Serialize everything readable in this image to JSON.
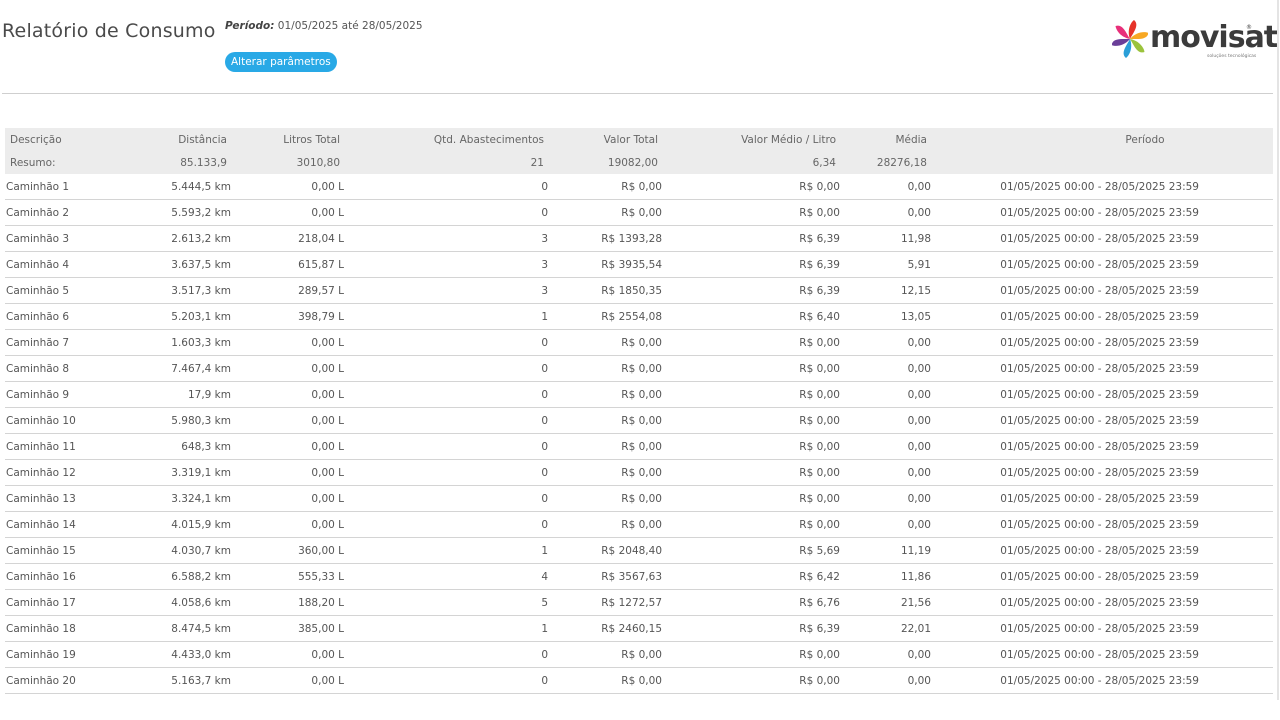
{
  "header": {
    "title": "Relatório de Consumo",
    "period_label": "Período:",
    "period_value": " 01/05/2025 até 28/05/2025",
    "change_button": "Alterar parâmetros"
  },
  "logo": {
    "wordmark": "movisat",
    "trademark": "®",
    "tagline": "soluções tecnológicas",
    "colors": [
      "#e63329",
      "#f7a823",
      "#9bc33c",
      "#2a9fd8",
      "#6a3e98",
      "#e8307a"
    ]
  },
  "table": {
    "columns": [
      "Descrição",
      "Distância",
      "Litros Total",
      "Qtd. Abastecimentos",
      "Valor Total",
      "Valor Médio / Litro",
      "Média",
      "Período"
    ],
    "summary": {
      "label": "Resumo:",
      "distance": "85.133,9",
      "liters": "3010,80",
      "refuels": "21",
      "total": "19082,00",
      "avg_price": "6,34",
      "average": "28276,18",
      "period": ""
    },
    "rows": [
      {
        "name": "Caminhão 1",
        "distance": "5.444,5 km",
        "liters": "0,00 L",
        "refuels": "0",
        "total": "R$ 0,00",
        "avg_price": "R$ 0,00",
        "average": "0,00",
        "period": "01/05/2025 00:00 - 28/05/2025 23:59"
      },
      {
        "name": "Caminhão 2",
        "distance": "5.593,2 km",
        "liters": "0,00 L",
        "refuels": "0",
        "total": "R$ 0,00",
        "avg_price": "R$ 0,00",
        "average": "0,00",
        "period": "01/05/2025 00:00 - 28/05/2025 23:59"
      },
      {
        "name": "Caminhão 3",
        "distance": "2.613,2 km",
        "liters": "218,04 L",
        "refuels": "3",
        "total": "R$ 1393,28",
        "avg_price": "R$ 6,39",
        "average": "11,98",
        "period": "01/05/2025 00:00 - 28/05/2025 23:59"
      },
      {
        "name": "Caminhão 4",
        "distance": "3.637,5 km",
        "liters": "615,87 L",
        "refuels": "3",
        "total": "R$ 3935,54",
        "avg_price": "R$ 6,39",
        "average": "5,91",
        "period": "01/05/2025 00:00 - 28/05/2025 23:59"
      },
      {
        "name": "Caminhão 5",
        "distance": "3.517,3 km",
        "liters": "289,57 L",
        "refuels": "3",
        "total": "R$ 1850,35",
        "avg_price": "R$ 6,39",
        "average": "12,15",
        "period": "01/05/2025 00:00 - 28/05/2025 23:59"
      },
      {
        "name": "Caminhão 6",
        "distance": "5.203,1 km",
        "liters": "398,79 L",
        "refuels": "1",
        "total": "R$ 2554,08",
        "avg_price": "R$ 6,40",
        "average": "13,05",
        "period": "01/05/2025 00:00 - 28/05/2025 23:59"
      },
      {
        "name": "Caminhão 7",
        "distance": "1.603,3 km",
        "liters": "0,00 L",
        "refuels": "0",
        "total": "R$ 0,00",
        "avg_price": "R$ 0,00",
        "average": "0,00",
        "period": "01/05/2025 00:00 - 28/05/2025 23:59"
      },
      {
        "name": "Caminhão 8",
        "distance": "7.467,4 km",
        "liters": "0,00 L",
        "refuels": "0",
        "total": "R$ 0,00",
        "avg_price": "R$ 0,00",
        "average": "0,00",
        "period": "01/05/2025 00:00 - 28/05/2025 23:59"
      },
      {
        "name": "Caminhão 9",
        "distance": "17,9 km",
        "liters": "0,00 L",
        "refuels": "0",
        "total": "R$ 0,00",
        "avg_price": "R$ 0,00",
        "average": "0,00",
        "period": "01/05/2025 00:00 - 28/05/2025 23:59"
      },
      {
        "name": "Caminhão 10",
        "distance": "5.980,3 km",
        "liters": "0,00 L",
        "refuels": "0",
        "total": "R$ 0,00",
        "avg_price": "R$ 0,00",
        "average": "0,00",
        "period": "01/05/2025 00:00 - 28/05/2025 23:59"
      },
      {
        "name": "Caminhão 11",
        "distance": "648,3 km",
        "liters": "0,00 L",
        "refuels": "0",
        "total": "R$ 0,00",
        "avg_price": "R$ 0,00",
        "average": "0,00",
        "period": "01/05/2025 00:00 - 28/05/2025 23:59"
      },
      {
        "name": "Caminhão 12",
        "distance": "3.319,1 km",
        "liters": "0,00 L",
        "refuels": "0",
        "total": "R$ 0,00",
        "avg_price": "R$ 0,00",
        "average": "0,00",
        "period": "01/05/2025 00:00 - 28/05/2025 23:59"
      },
      {
        "name": "Caminhão 13",
        "distance": "3.324,1 km",
        "liters": "0,00 L",
        "refuels": "0",
        "total": "R$ 0,00",
        "avg_price": "R$ 0,00",
        "average": "0,00",
        "period": "01/05/2025 00:00 - 28/05/2025 23:59"
      },
      {
        "name": "Caminhão 14",
        "distance": "4.015,9 km",
        "liters": "0,00 L",
        "refuels": "0",
        "total": "R$ 0,00",
        "avg_price": "R$ 0,00",
        "average": "0,00",
        "period": "01/05/2025 00:00 - 28/05/2025 23:59"
      },
      {
        "name": "Caminhão 15",
        "distance": "4.030,7 km",
        "liters": "360,00 L",
        "refuels": "1",
        "total": "R$ 2048,40",
        "avg_price": "R$ 5,69",
        "average": "11,19",
        "period": "01/05/2025 00:00 - 28/05/2025 23:59"
      },
      {
        "name": "Caminhão 16",
        "distance": "6.588,2 km",
        "liters": "555,33 L",
        "refuels": "4",
        "total": "R$ 3567,63",
        "avg_price": "R$ 6,42",
        "average": "11,86",
        "period": "01/05/2025 00:00 - 28/05/2025 23:59"
      },
      {
        "name": "Caminhão 17",
        "distance": "4.058,6 km",
        "liters": "188,20 L",
        "refuels": "5",
        "total": "R$ 1272,57",
        "avg_price": "R$ 6,76",
        "average": "21,56",
        "period": "01/05/2025 00:00 - 28/05/2025 23:59"
      },
      {
        "name": "Caminhão 18",
        "distance": "8.474,5 km",
        "liters": "385,00 L",
        "refuels": "1",
        "total": "R$ 2460,15",
        "avg_price": "R$ 6,39",
        "average": "22,01",
        "period": "01/05/2025 00:00 - 28/05/2025 23:59"
      },
      {
        "name": "Caminhão 19",
        "distance": "4.433,0 km",
        "liters": "0,00 L",
        "refuels": "0",
        "total": "R$ 0,00",
        "avg_price": "R$ 0,00",
        "average": "0,00",
        "period": "01/05/2025 00:00 - 28/05/2025 23:59"
      },
      {
        "name": "Caminhão 20",
        "distance": "5.163,7 km",
        "liters": "0,00 L",
        "refuels": "0",
        "total": "R$ 0,00",
        "avg_price": "R$ 0,00",
        "average": "0,00",
        "period": "01/05/2025 00:00 - 28/05/2025 23:59"
      }
    ]
  }
}
